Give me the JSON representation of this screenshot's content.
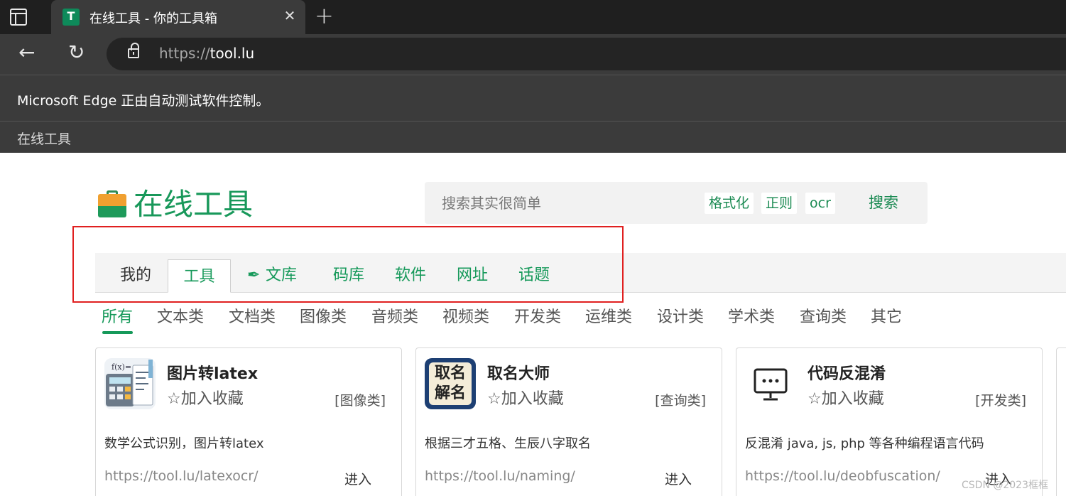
{
  "browser": {
    "tab_title": "在线工具 - 你的工具箱",
    "url_scheme": "https://",
    "url_host": "tool.lu",
    "infobar_text": "Microsoft Edge 正由自动测试软件控制。",
    "favorites_item": "在线工具",
    "icons": [
      "tab-actions-icon",
      "close-icon",
      "plus-icon",
      "back-arrow-icon",
      "reload-icon",
      "lock-icon"
    ]
  },
  "header": {
    "logo_text": "在线工具",
    "search_placeholder": "搜索其实很简单",
    "chips": [
      "格式化",
      "正则",
      "ocr"
    ],
    "search_button": "搜索"
  },
  "nav": {
    "tabs": [
      {
        "label": "我的"
      },
      {
        "label": "工具",
        "active": true
      },
      {
        "label": "文库",
        "icon": "quill-icon"
      },
      {
        "label": "码库"
      },
      {
        "label": "软件"
      },
      {
        "label": "网址"
      },
      {
        "label": "话题"
      }
    ]
  },
  "categories": [
    "所有",
    "文本类",
    "文档类",
    "图像类",
    "音频类",
    "视频类",
    "开发类",
    "运维类",
    "设计类",
    "学术类",
    "查询类",
    "其它"
  ],
  "active_category": "所有",
  "cards": [
    {
      "title": "图片转latex",
      "favorite_label": "加入收藏",
      "category": "[图像类]",
      "description": "数学公式识别，图片转latex",
      "url": "https://tool.lu/latexocr/",
      "enter": "进入",
      "icon": "calculator-icon"
    },
    {
      "title": "取名大师",
      "favorite_label": "加入收藏",
      "category": "[查询类]",
      "description": "根据三才五格、生辰八字取名",
      "url": "https://tool.lu/naming/",
      "enter": "进入",
      "icon": "naming-icon",
      "icon_text": "取名解名"
    },
    {
      "title": "代码反混淆",
      "favorite_label": "加入收藏",
      "category": "[开发类]",
      "description": "反混淆 java, js, php 等各种编程语言代码",
      "url": "https://tool.lu/deobfuscation/",
      "enter": "进入",
      "icon": "terminal-icon"
    }
  ],
  "watermark": "CSDN @2023框框",
  "colors": {
    "brand_green": "#16995a",
    "highlight_red": "#e02020",
    "chrome_dark": "#3b3b3b"
  }
}
